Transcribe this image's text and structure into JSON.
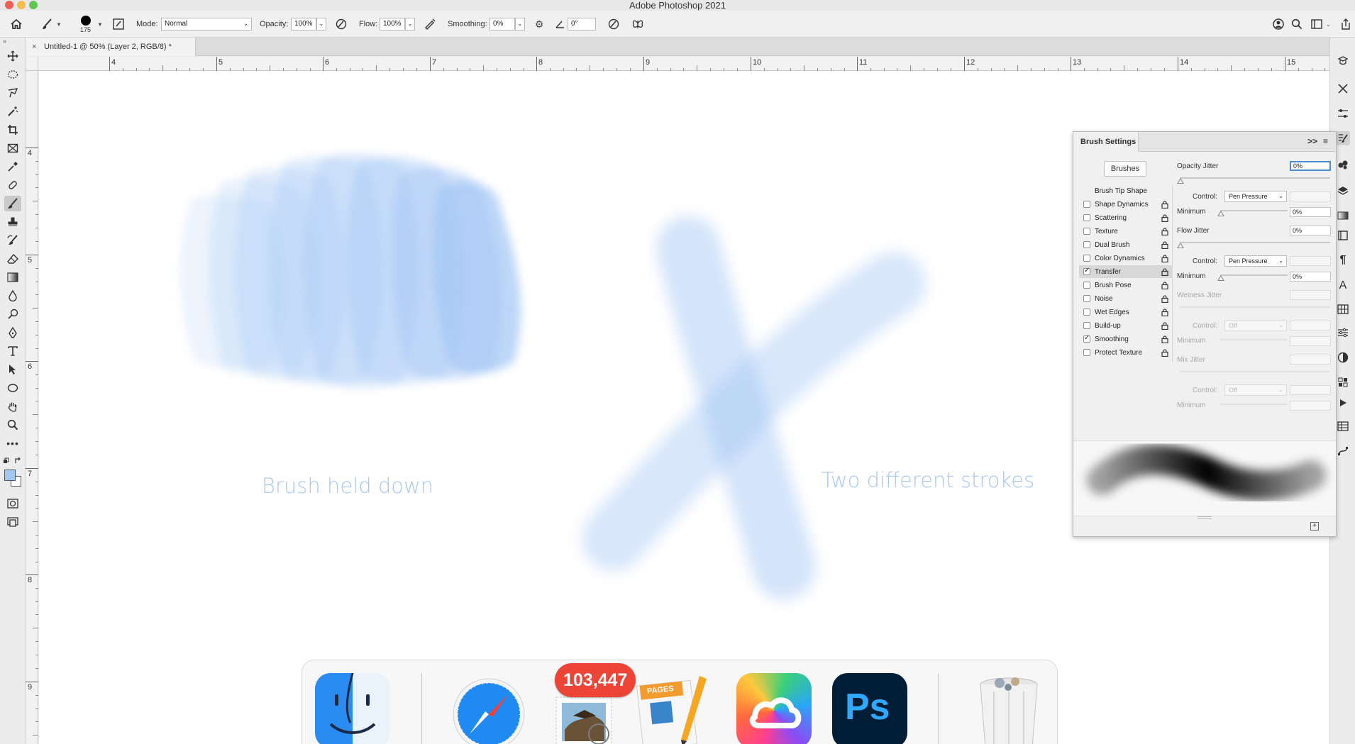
{
  "window": {
    "title": "Adobe Photoshop 2021"
  },
  "options_bar": {
    "brush_size": "175",
    "mode_label": "Mode:",
    "mode_value": "Normal",
    "opacity_label": "Opacity:",
    "opacity_value": "100%",
    "flow_label": "Flow:",
    "flow_value": "100%",
    "smoothing_label": "Smoothing:",
    "smoothing_value": "0%",
    "angle_value": "0°"
  },
  "document": {
    "tab_title": "Untitled-1 @ 50% (Layer 2, RGB/8) *",
    "close_glyph": "×"
  },
  "rulers": {
    "horizontal": [
      "4",
      "5",
      "6",
      "7",
      "8",
      "9",
      "10",
      "11",
      "12",
      "13",
      "14",
      "15"
    ],
    "vertical": [
      "4",
      "5",
      "6",
      "7",
      "8",
      "9"
    ]
  },
  "canvas": {
    "label_left": "Brush held down",
    "label_right": "Two different strokes",
    "stroke_color": "#a3c6f5"
  },
  "brush_panel": {
    "title": "Brush Settings",
    "collapse_glyph": ">>",
    "brushes_button": "Brushes",
    "options": [
      {
        "label": "Brush Tip Shape",
        "checkbox": false,
        "checked": false,
        "lock": false
      },
      {
        "label": "Shape Dynamics",
        "checkbox": true,
        "checked": false,
        "lock": true
      },
      {
        "label": "Scattering",
        "checkbox": true,
        "checked": false,
        "lock": true
      },
      {
        "label": "Texture",
        "checkbox": true,
        "checked": false,
        "lock": true
      },
      {
        "label": "Dual Brush",
        "checkbox": true,
        "checked": false,
        "lock": true
      },
      {
        "label": "Color Dynamics",
        "checkbox": true,
        "checked": false,
        "lock": true
      },
      {
        "label": "Transfer",
        "checkbox": true,
        "checked": true,
        "lock": true,
        "selected": true
      },
      {
        "label": "Brush Pose",
        "checkbox": true,
        "checked": false,
        "lock": true
      },
      {
        "label": "Noise",
        "checkbox": true,
        "checked": false,
        "lock": true
      },
      {
        "label": "Wet Edges",
        "checkbox": true,
        "checked": false,
        "lock": true
      },
      {
        "label": "Build-up",
        "checkbox": true,
        "checked": false,
        "lock": true
      },
      {
        "label": "Smoothing",
        "checkbox": true,
        "checked": true,
        "lock": true
      },
      {
        "label": "Protect Texture",
        "checkbox": true,
        "checked": false,
        "lock": true
      }
    ],
    "opacity_jitter": {
      "label": "Opacity Jitter",
      "value": "0%"
    },
    "opacity_control": {
      "label": "Control:",
      "value": "Pen Pressure"
    },
    "opacity_minimum": {
      "label": "Minimum",
      "value": "0%"
    },
    "flow_jitter": {
      "label": "Flow Jitter",
      "value": "0%"
    },
    "flow_control": {
      "label": "Control:",
      "value": "Pen Pressure"
    },
    "flow_minimum": {
      "label": "Minimum",
      "value": "0%"
    },
    "wetness_jitter": {
      "label": "Wetness Jitter"
    },
    "wetness_control": {
      "label": "Control:",
      "value": "Off"
    },
    "wetness_minimum": {
      "label": "Minimum"
    },
    "mix_jitter": {
      "label": "Mix Jitter"
    },
    "mix_control": {
      "label": "Control:",
      "value": "Off"
    },
    "mix_minimum": {
      "label": "Minimum"
    }
  },
  "dock": {
    "mail_badge": "103,447",
    "pages_label": "PAGES",
    "photoshop_label": "Ps"
  },
  "colors": {
    "foreground": "#a3c6f5",
    "background": "#ffffff",
    "selection_focus": "#4a8bd6"
  },
  "icons": {
    "toolbar": [
      "move-icon",
      "marquee-icon",
      "lasso-icon",
      "magic-wand-icon",
      "crop-icon",
      "frame-icon",
      "eyedropper-icon",
      "healing-icon",
      "brush-icon",
      "stamp-icon",
      "history-brush-icon",
      "eraser-icon",
      "gradient-icon",
      "blur-icon",
      "dodge-icon",
      "pen-icon",
      "type-icon",
      "path-select-icon",
      "ellipse-icon",
      "hand-icon",
      "zoom-icon",
      "more-tools-icon"
    ],
    "right_dock": [
      "learn-icon",
      "tools-icon",
      "adjust-icon",
      "brush-settings-icon",
      "brushes-icon",
      "layers-icon",
      "gradients-icon",
      "libraries-icon",
      "paragraph-icon",
      "character-icon",
      "swatches-icon",
      "properties-icon",
      "color-icon",
      "channels-icon",
      "actions-icon",
      "table-icon",
      "paths-icon"
    ]
  }
}
